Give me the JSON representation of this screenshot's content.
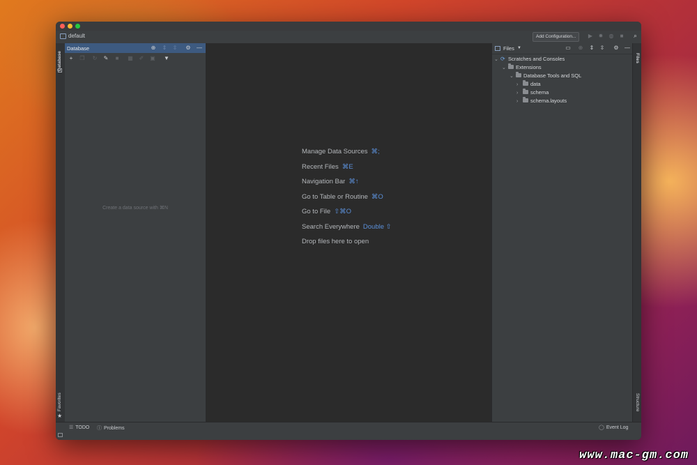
{
  "window": {
    "project_name": "default",
    "add_config_label": "Add Configuration..."
  },
  "left_strip": {
    "database_tab": "Database",
    "favorites_tab": "Favorites"
  },
  "right_strip": {
    "files_tab": "Files",
    "structure_tab": "Structure"
  },
  "database_panel": {
    "title": "Database",
    "empty_text": "Create a data source with ⌘N"
  },
  "editor": {
    "hints": [
      {
        "label": "Manage Data Sources",
        "shortcut": "⌘;"
      },
      {
        "label": "Recent Files",
        "shortcut": "⌘E"
      },
      {
        "label": "Navigation Bar",
        "shortcut": "⌘↑"
      },
      {
        "label": "Go to Table or Routine",
        "shortcut": "⌘O"
      },
      {
        "label": "Go to File",
        "shortcut": "⇧⌘O"
      },
      {
        "label": "Search Everywhere",
        "shortcut": "Double ⇧"
      },
      {
        "label": "Drop files here to open",
        "shortcut": ""
      }
    ]
  },
  "files_panel": {
    "title": "Files",
    "tree": [
      {
        "label": "Scratches and Consoles",
        "expanded": true
      },
      {
        "label": "Extensions",
        "expanded": true
      },
      {
        "label": "Database Tools and SQL",
        "expanded": true
      },
      {
        "label": "data",
        "expanded": false
      },
      {
        "label": "schema",
        "expanded": false
      },
      {
        "label": "schema.layouts",
        "expanded": false
      }
    ]
  },
  "statusbar": {
    "todo": "TODO",
    "problems": "Problems",
    "event_log": "Event Log"
  },
  "watermark": "www.mac-gm.com",
  "colors": {
    "accent": "#5b8fd8",
    "panel_header_selected": "#3d5a80",
    "editor_bg": "#2b2b2b",
    "panel_bg": "#3c3f41"
  }
}
